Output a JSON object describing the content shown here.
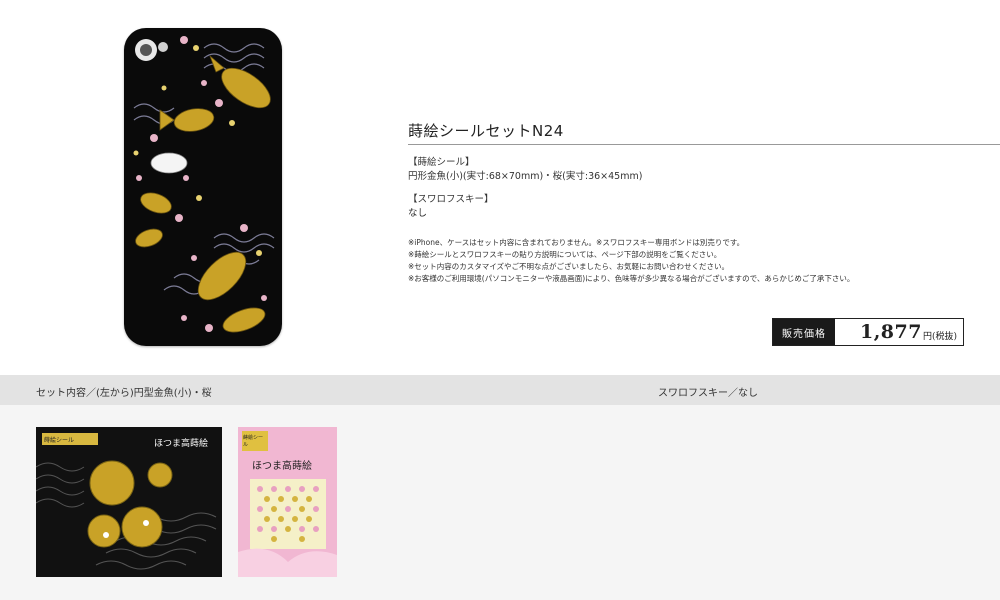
{
  "product": {
    "title": "蒔絵シールセットN24",
    "section1_heading": "【蒔絵シール】",
    "section1_body": "円形金魚(小)(実寸:68×70mm)・桜(実寸:36×45mm)",
    "section2_heading": "【スワロフスキー】",
    "section2_body": "なし",
    "notes": [
      "※iPhone、ケースはセット内容に含まれておりません。※スワロフスキー専用ボンドは別売りです。",
      "※蒔絵シールとスワロフスキーの貼り方説明については、ページ下部の説明をご覧ください。",
      "※セット内容のカスタマイズやご不明な点がございましたら、お気軽にお問い合わせください。",
      "※お客様のご利用環境(パソコンモニターや液晶画面)により、色味等が多少異なる場合がございますので、あらかじめご了承下さい。"
    ]
  },
  "price": {
    "label": "販売価格",
    "value": "1,877",
    "unit": "円(税抜)"
  },
  "set_contents": {
    "left_heading": "セット内容／(左から)円型金魚(小)・桜",
    "right_heading": "スワロフスキー／なし",
    "pack1": {
      "tag": "蒔絵シール",
      "brand": "ほつま高蒔絵"
    },
    "pack2": {
      "tag": "蒔絵シール",
      "brand": "ほつま高蒔絵"
    }
  },
  "colors": {
    "case": "#0a0a0a",
    "gold": "#c9a227",
    "sakura": "#e8b4c8",
    "pack_pink": "#f1b7d2"
  }
}
